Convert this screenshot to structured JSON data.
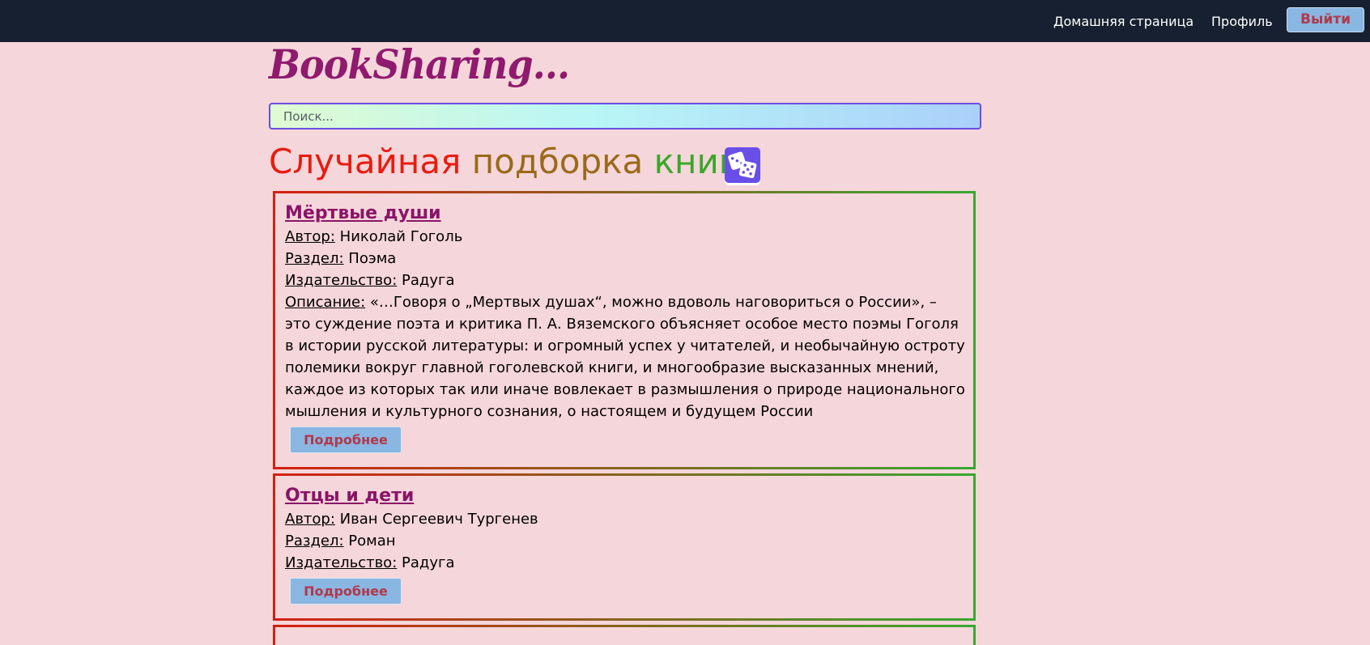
{
  "nav": {
    "home": "Домашняя страница",
    "profile": "Профиль",
    "logout": "Выйти"
  },
  "logo": "BookSharing...",
  "search": {
    "placeholder": "Поиск..."
  },
  "heading": {
    "words": [
      "Случайная",
      "подборка",
      "книг"
    ],
    "colors": [
      "#e81c10",
      "#9a6a1a",
      "#3aa82a"
    ]
  },
  "labels": {
    "author": "Автор:",
    "section": "Раздел:",
    "publisher": "Издательство:",
    "description": "Описание:",
    "more": "Подробнее"
  },
  "books": [
    {
      "title": "Мёртвые души",
      "author": "Николай Гоголь",
      "section": "Поэма",
      "publisher": "Радуга",
      "description": "«…Говоря о „Мертвых душах“, можно вдоволь наговориться о России», – это суждение поэта и критика П. А. Вяземского объясняет особое место поэмы Гоголя в истории русской литературы: и огромный успех у читателей, и необычайную остроту полемики вокруг главной гоголевской книги, и многообразие высказанных мнений, каждое из которых так или иначе вовлекает в размышления о природе национального мышления и культурного сознания, о настоящем и будущем России"
    },
    {
      "title": "Отцы и дети",
      "author": "Иван Сергеевич Тургенев",
      "section": "Роман",
      "publisher": "Радуга"
    }
  ],
  "colors": {
    "topbar": "#172030",
    "background": "#f5d6da",
    "accent_button": "#8ab6e2",
    "button_text": "#b0394a",
    "title": "#8a1468",
    "dice": "#6a4ee8"
  },
  "icons": {
    "random": "dice-icon"
  }
}
